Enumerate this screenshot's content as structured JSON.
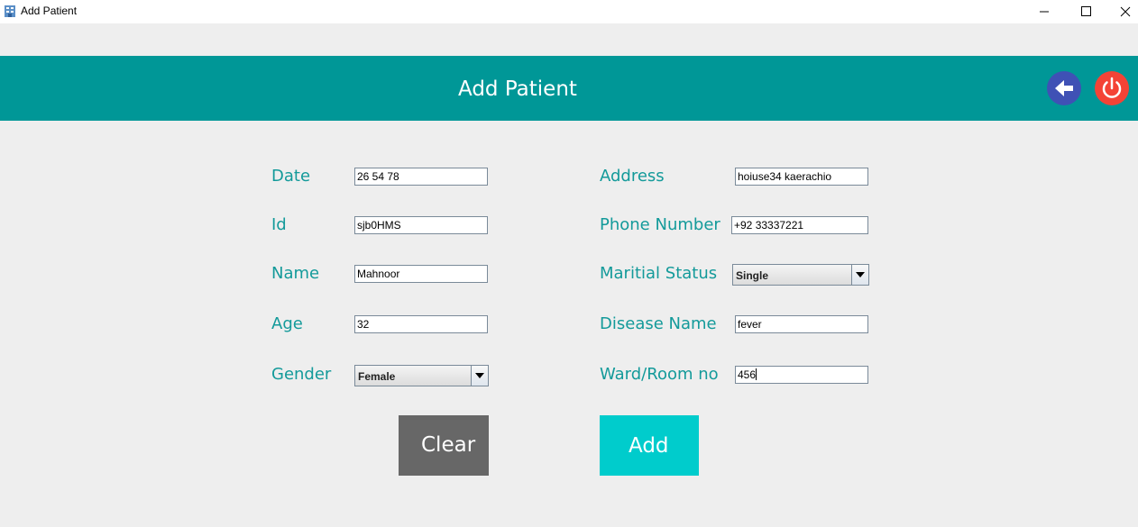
{
  "window": {
    "title": "Add Patient"
  },
  "header": {
    "title": "Add Patient"
  },
  "form": {
    "date": {
      "label": "Date",
      "value": "26 54 78"
    },
    "id": {
      "label": "Id",
      "value": "sjb0HMS"
    },
    "name": {
      "label": "Name",
      "value": "Mahnoor"
    },
    "age": {
      "label": "Age",
      "value": "32"
    },
    "gender": {
      "label": "Gender",
      "selected": "Female"
    },
    "address": {
      "label": "Address",
      "value": "hoiuse34 kaerachio"
    },
    "phone": {
      "label": "Phone Number",
      "value": "+92 33337221"
    },
    "marital_status": {
      "label": "Maritial Status",
      "selected": "Single"
    },
    "disease": {
      "label": "Disease Name",
      "value": "fever"
    },
    "ward": {
      "label": "Ward/Room no",
      "value": "456"
    }
  },
  "buttons": {
    "clear": "Clear",
    "add": "Add"
  },
  "colors": {
    "header_bg": "#009797",
    "label": "#139a9a",
    "back_button": "#3f51b5",
    "power_button": "#f44336",
    "clear_button": "#676767",
    "add_button": "#00cccc"
  },
  "icons": {
    "app": "hospital-app-icon",
    "back": "arrow-left-icon",
    "power": "power-icon",
    "minimize": "minimize-icon",
    "maximize": "maximize-icon",
    "close": "close-icon"
  }
}
